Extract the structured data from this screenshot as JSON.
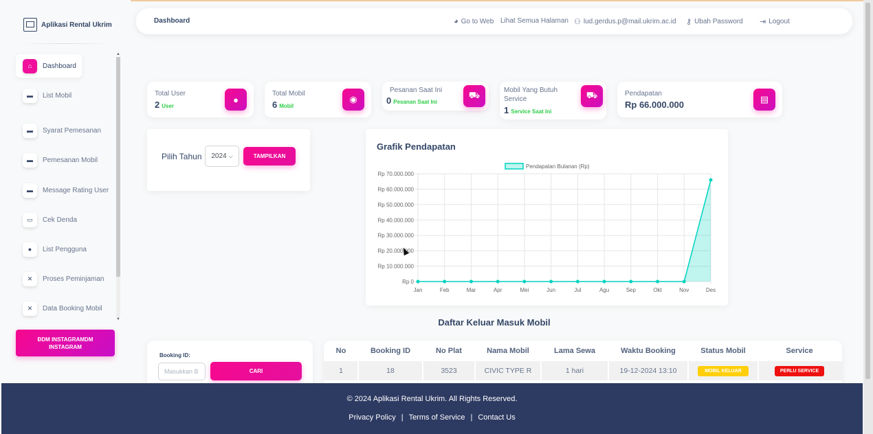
{
  "app": {
    "brand": "Aplikasi Rental Ukrim"
  },
  "sidebar": {
    "items": [
      {
        "label": "Dashboard",
        "icon": "home-icon"
      },
      {
        "label": "List Mobil",
        "icon": "car-icon"
      },
      {
        "label": "Syarat Pemesanan",
        "icon": "car-icon"
      },
      {
        "label": "Pemesanan Mobil",
        "icon": "car-icon"
      },
      {
        "label": "Message Rating User",
        "icon": "car-icon"
      },
      {
        "label": "Cek Denda",
        "icon": "card-icon"
      },
      {
        "label": "List Pengguna",
        "icon": "user-icon"
      },
      {
        "label": "Proses Peminjaman",
        "icon": "tools-icon"
      },
      {
        "label": "Data Booking Mobil",
        "icon": "tools-icon"
      }
    ],
    "instagram_button": "ÐDM INSTAGRAMDM\nINSTAGRAM"
  },
  "topnav": {
    "title": "Dashboard",
    "go_to_web": "Go to Web",
    "all_pages": "Lihat Semua Halaman",
    "email": "lud.gerdus.p@mail.ukrim.ac.id",
    "change_password": "Ubah Password",
    "logout": "Logout"
  },
  "stats": [
    {
      "label": "Total User",
      "value": "2",
      "suffix": "User"
    },
    {
      "label": "Total Mobil",
      "value": "6",
      "suffix": "Mobil"
    },
    {
      "label": "Pesanan Saat Ini",
      "value": "0",
      "suffix": "Pesanan Saat Ini"
    },
    {
      "label": "Mobil Yang Butuh Service",
      "value": "1",
      "suffix": "Service Saat Ini"
    },
    {
      "label": "Pendapatan",
      "value": "Rp 66.000.000",
      "suffix": ""
    }
  ],
  "filter": {
    "label": "Pilih Tahun",
    "year": "2024",
    "button": "TAMPILKAN"
  },
  "chart_title": "Grafik Pendapatan",
  "chart_data": {
    "type": "area",
    "title": "Grafik Pendapatan",
    "categories": [
      "Jan",
      "Feb",
      "Mar",
      "Apr",
      "Mei",
      "Jun",
      "Jul",
      "Agu",
      "Sep",
      "Okt",
      "Nov",
      "Des"
    ],
    "series": [
      {
        "name": "Pendapatan Bulanan (Rp)",
        "values": [
          0,
          0,
          0,
          0,
          0,
          0,
          0,
          0,
          0,
          0,
          0,
          66000000
        ],
        "color": "#00d4c0"
      }
    ],
    "ylim": [
      0,
      70000000
    ],
    "yticks": [
      "Rp 0",
      "Rp 10.000.000",
      "Rp 20.000.000",
      "Rp 30.000.000",
      "Rp 40.000.000",
      "Rp 50.000.000",
      "Rp 60.000.000",
      "Rp 70.000.000"
    ],
    "grid": true,
    "legend": "top-center"
  },
  "table": {
    "title": "Daftar Keluar Masuk Mobil",
    "booking_label": "Booking ID:",
    "booking_placeholder": "Masukkan B",
    "search_button": "CARI",
    "headers": [
      "No",
      "Booking ID",
      "No Plat",
      "Nama Mobil",
      "Lama Sewa",
      "Waktu Booking",
      "Status Mobil",
      "Service"
    ],
    "rows": [
      {
        "no": "1",
        "booking_id": "18",
        "plat": "3523",
        "nama": "CIVIC TYPE R",
        "lama": "1 hari",
        "waktu": "19-12-2024 13:10",
        "status": "MOBIL KELUAR",
        "service": "PERLU SERVICE"
      }
    ]
  },
  "footer": {
    "copyright": "© 2024 Aplikasi Rental Ukrim. All Rights Reserved.",
    "privacy": "Privacy Policy",
    "terms": "Terms of Service",
    "contact": "Contact Us"
  },
  "colors": {
    "accent": "#f0109c",
    "chart_line": "#00d4c0",
    "footer_bg": "#2d3a62",
    "badge_yellow": "#ffcf0a",
    "badge_red": "#ef1010"
  }
}
